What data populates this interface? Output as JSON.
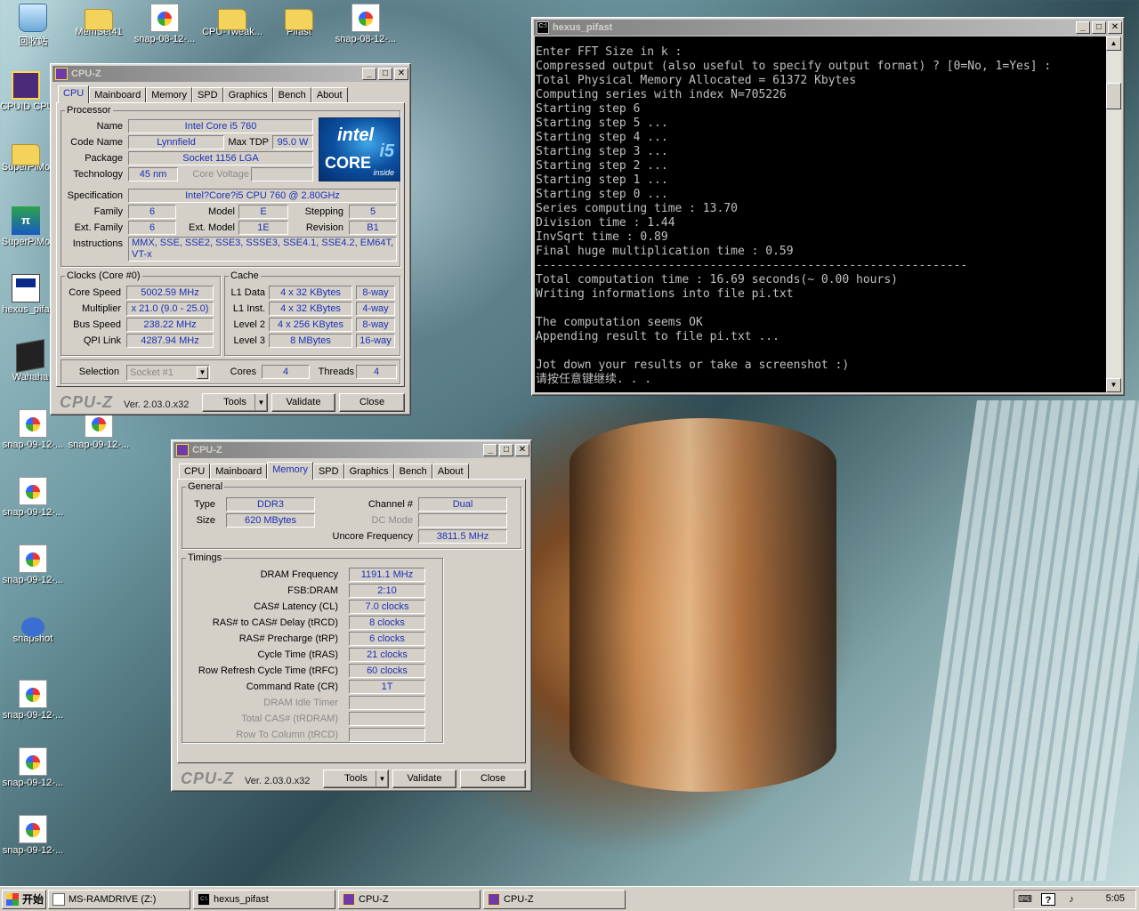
{
  "desktop": {
    "icons_top": [
      "回收站",
      "MemSet41",
      "snap-08-12-...",
      "CPU-Tweak...",
      "Pifast",
      "snap-08-12-..."
    ],
    "icons_left": [
      "CPUID CPU",
      "SuperPiMo",
      "SuperPiMo",
      "hexus_pifa",
      "Wahaha",
      "snap-09-12-...",
      "snap-09-12-...",
      "snap-09-12-...",
      "snap-09-12-...",
      "snapshot",
      "snap-09-12-...",
      "snap-09-12-...",
      "snap-09-12-..."
    ]
  },
  "cpuz1": {
    "title": "CPU-Z",
    "tabs": [
      "CPU",
      "Mainboard",
      "Memory",
      "SPD",
      "Graphics",
      "Bench",
      "About"
    ],
    "processor": {
      "legend": "Processor",
      "name_label": "Name",
      "name": "Intel Core i5 760",
      "codename_label": "Code Name",
      "codename": "Lynnfield",
      "maxtdp_label": "Max TDP",
      "maxtdp": "95.0 W",
      "package_label": "Package",
      "package": "Socket 1156 LGA",
      "technology_label": "Technology",
      "technology": "45 nm",
      "corevoltage_label": "Core Voltage",
      "spec_label": "Specification",
      "spec": "Intel?Core?i5 CPU         760  @ 2.80GHz",
      "family_label": "Family",
      "family": "6",
      "model_label": "Model",
      "model": "E",
      "stepping_label": "Stepping",
      "stepping": "5",
      "extfamily_label": "Ext. Family",
      "extfamily": "6",
      "extmodel_label": "Ext. Model",
      "extmodel": "1E",
      "revision_label": "Revision",
      "revision": "B1",
      "instr_label": "Instructions",
      "instr": "MMX, SSE, SSE2, SSE3, SSSE3, SSE4.1, SSE4.2, EM64T, VT-x",
      "logo": {
        "intel": "intel",
        "core": "CORE",
        "i5": "i5",
        "inside": "inside"
      }
    },
    "clocks": {
      "legend": "Clocks (Core #0)",
      "corespeed_label": "Core Speed",
      "corespeed": "5002.59 MHz",
      "multiplier_label": "Multiplier",
      "multiplier": "x 21.0 (9.0 - 25.0)",
      "busspeed_label": "Bus Speed",
      "busspeed": "238.22 MHz",
      "qpilink_label": "QPI Link",
      "qpilink": "4287.94 MHz"
    },
    "cache": {
      "legend": "Cache",
      "rows": [
        {
          "label": "L1 Data",
          "size": "4 x 32 KBytes",
          "way": "8-way"
        },
        {
          "label": "L1 Inst.",
          "size": "4 x 32 KBytes",
          "way": "4-way"
        },
        {
          "label": "Level 2",
          "size": "4 x 256 KBytes",
          "way": "8-way"
        },
        {
          "label": "Level 3",
          "size": "8 MBytes",
          "way": "16-way"
        }
      ]
    },
    "selection_label": "Selection",
    "selection": "Socket #1",
    "cores_label": "Cores",
    "cores": "4",
    "threads_label": "Threads",
    "threads": "4",
    "brand": "CPU-Z",
    "version": "Ver. 2.03.0.x32",
    "tools": "Tools",
    "validate": "Validate",
    "close": "Close"
  },
  "cpuz2": {
    "title": "CPU-Z",
    "tabs": [
      "CPU",
      "Mainboard",
      "Memory",
      "SPD",
      "Graphics",
      "Bench",
      "About"
    ],
    "general": {
      "legend": "General",
      "type_label": "Type",
      "type": "DDR3",
      "size_label": "Size",
      "size": "620 MBytes",
      "channel_label": "Channel #",
      "channel": "Dual",
      "dcmode_label": "DC Mode",
      "uncore_label": "Uncore Frequency",
      "uncore": "3811.5 MHz"
    },
    "timings": {
      "legend": "Timings",
      "rows": [
        {
          "label": "DRAM Frequency",
          "value": "1191.1 MHz"
        },
        {
          "label": "FSB:DRAM",
          "value": "2:10"
        },
        {
          "label": "CAS# Latency (CL)",
          "value": "7.0 clocks"
        },
        {
          "label": "RAS# to CAS# Delay (tRCD)",
          "value": "8 clocks"
        },
        {
          "label": "RAS# Precharge (tRP)",
          "value": "6 clocks"
        },
        {
          "label": "Cycle Time (tRAS)",
          "value": "21 clocks"
        },
        {
          "label": "Row Refresh Cycle Time (tRFC)",
          "value": "60 clocks"
        },
        {
          "label": "Command Rate (CR)",
          "value": "1T"
        },
        {
          "label": "DRAM Idle Timer",
          "value": ""
        },
        {
          "label": "Total CAS# (tRDRAM)",
          "value": ""
        },
        {
          "label": "Row To Column (tRCD)",
          "value": ""
        }
      ]
    },
    "brand": "CPU-Z",
    "version": "Ver. 2.03.0.x32",
    "tools": "Tools",
    "validate": "Validate",
    "close": "Close"
  },
  "console": {
    "title": "hexus_pifast",
    "lines": [
      "Enter FFT Size in k :",
      "Compressed output (also useful to specify output format) ? [0=No, 1=Yes] :",
      "Total Physical Memory Allocated = 61372 Kbytes",
      "Computing series with index N=705226",
      "Starting step 6",
      "Starting step 5 ...",
      "Starting step 4 ...",
      "Starting step 3 ...",
      "Starting step 2 ...",
      "Starting step 1 ...",
      "Starting step 0 ...",
      "Series computing time : 13.70",
      "Division time : 1.44",
      "InvSqrt time : 0.89",
      "Final huge multiplication time : 0.59",
      "--------------------------------------------------------------",
      "Total computation time : 16.69 seconds(~ 0.00 hours)",
      "Writing informations into file pi.txt",
      "",
      "The computation seems OK",
      "Appending result to file pi.txt ...",
      "",
      "Jot down your results or take a screenshot :)",
      "请按任意键继续. . ."
    ]
  },
  "taskbar": {
    "start": "开始",
    "tasks": [
      "MS-RAMDRIVE (Z:)",
      "hexus_pifast",
      "CPU-Z",
      "CPU-Z"
    ],
    "clock": "5:05"
  }
}
